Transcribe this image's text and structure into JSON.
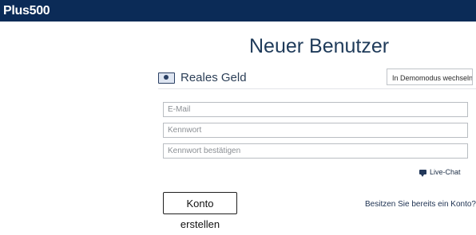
{
  "header": {
    "logo_text": "Plus500",
    "background_color": "#0b2b57"
  },
  "page": {
    "title": "Neuer Benutzer"
  },
  "account": {
    "type_label": "Reales Geld",
    "demo_button_label": "In Demomodus wechseln",
    "money_icon": "money-icon"
  },
  "form": {
    "email_placeholder": "E-Mail",
    "password_placeholder": "Kennwort",
    "confirm_password_placeholder": "Kennwort bestätigen",
    "email_value": "",
    "password_value": "",
    "confirm_password_value": ""
  },
  "support": {
    "live_chat_label": "Live-Chat",
    "chat_icon": "chat-icon"
  },
  "actions": {
    "create_account_label": "Konto erstellen",
    "existing_account_label": "Besitzen Sie bereits ein Konto?"
  }
}
